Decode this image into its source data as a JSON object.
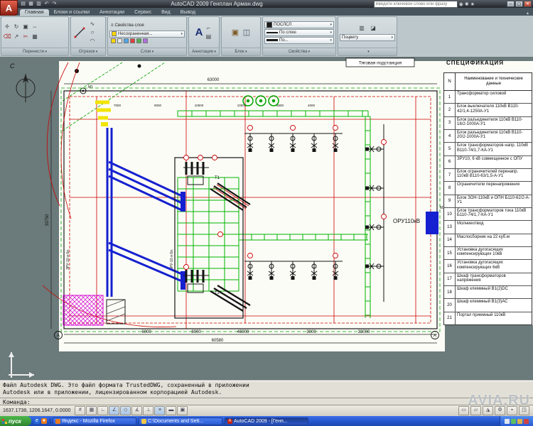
{
  "window": {
    "title": "AutoCAD 2009 Генплан Арман.dwg",
    "search_placeholder": "Введите ключевое слово или фразу",
    "minimize": "–",
    "maximize": "▢",
    "close": "✕"
  },
  "ribbon": {
    "tabs": [
      {
        "label": "Главная",
        "active": true
      },
      {
        "label": "Блоки и ссылки",
        "active": false
      },
      {
        "label": "Аннотации",
        "active": false
      },
      {
        "label": "Сервис",
        "active": false
      },
      {
        "label": "Вид",
        "active": false
      },
      {
        "label": "Вывод",
        "active": false
      }
    ],
    "panels": {
      "modify": {
        "label": "Перенести"
      },
      "draw": {
        "label": "Отрезок"
      },
      "layers": {
        "label": "Слои",
        "properties_button": "Свойства слоя",
        "layer_combo": "Несохраненная..."
      },
      "annotation": {
        "label": "Аннотации",
        "big_letter": "А"
      },
      "block": {
        "label": "Блок"
      },
      "properties": {
        "label": "Свойства",
        "color": "ПОСЛСЛ",
        "linetype": "По слою",
        "lineweight": "По..."
      },
      "utilities": {
        "match_combo": "Поцвету"
      }
    }
  },
  "canvas": {
    "north_letter": "С",
    "station_label": "Тяговая подстанция",
    "oru_label": "ОРУ110кВ",
    "t1": "Т1",
    "t2": "Т2",
    "m1": "М1",
    "m3": "М3",
    "axis_left": "А",
    "axis_right": "А",
    "side_label_1": "ЗРУ-10 и бл.",
    "side_label_2": "ЗРУ-10 и бл.",
    "dims": {
      "top": "63000",
      "left": "33750",
      "bottom_6000": "6000",
      "bottom_8000": "8000",
      "bottom_46000": "46000",
      "bottom_3000": "3000",
      "bottom_33000": "33000",
      "bottom_60580": "60580"
    },
    "chain": [
      "7000",
      "9000",
      "10000",
      "10000",
      "8500",
      "4000"
    ]
  },
  "spec_table": {
    "title": "СПЕЦИФИКАЦИЯ",
    "col_n": "N",
    "col_name": "Наименование и технические данные",
    "rows": [
      {
        "num": "1",
        "name": "Трансформатор силовой"
      },
      {
        "num": "2",
        "name": "Блок выключателя 110кВ В110-42/1,4-1250А-У1"
      },
      {
        "num": "3",
        "name": "Блок разъединителя 110кВ В110-18/2-1000А-У1"
      },
      {
        "num": "4",
        "name": "Блок разъединителя 110кВ В110-20/2-1000А-У1"
      },
      {
        "num": "5",
        "name": "Блок трансформаторов напр. 110кВ В110-74/1,7-КА-У1"
      },
      {
        "num": "6",
        "name": "ЗРУ10, 6 кВ совмещенное с ОПУ"
      },
      {
        "num": "7",
        "name": "Блок ограничителей перенапр. 110кВ В110-63/1,5-А-У1"
      },
      {
        "num": "8",
        "name": "Ограничители перенапряжения"
      },
      {
        "num": "9",
        "name": "Блок ЗОН-110кВ и ОПН Б110-62/2-А-У1"
      },
      {
        "num": "10",
        "name": "Блок трансформаторов тока 110кВ Б110-74/1,7-КА-У1"
      },
      {
        "num": "13",
        "name": "Молниеотвод"
      },
      {
        "num": "14",
        "name": "Маслосборник на 22 куб.м"
      },
      {
        "num": "15",
        "name": "Установка дугогасящих компенсирующих 10кВ"
      },
      {
        "num": "16",
        "name": "Установка дугогасящих компенсирующих 6кВ"
      },
      {
        "num": "17",
        "name": "Шкаф трансформаторов напряжения"
      },
      {
        "num": "18",
        "name": "Шкаф клеммный В1(2)DC"
      },
      {
        "num": "20",
        "name": "Шкаф клеммный В1(3)АС"
      },
      {
        "num": "21",
        "name": "Портал приемный 110кВ"
      }
    ]
  },
  "command": {
    "history": [
      "Файл Autodesk DWG.  Это файл формата TrustedDWG, сохраненный в приложении",
      "Autodesk или в приложении, лицензированном корпорацией Autodesk."
    ],
    "prompt": "Команда:"
  },
  "statusbar": {
    "coords": "1637.1738, 1206.1647, 0.0000"
  },
  "taskbar": {
    "start_label": "пуск",
    "tasks": [
      {
        "title": "Яндекс - Mozilla Firefox"
      },
      {
        "title": "C:\\Documents and Sett..."
      },
      {
        "title": "AutoCAD 2009 - [Генп..."
      }
    ]
  },
  "watermark": "AVIA.RU"
}
